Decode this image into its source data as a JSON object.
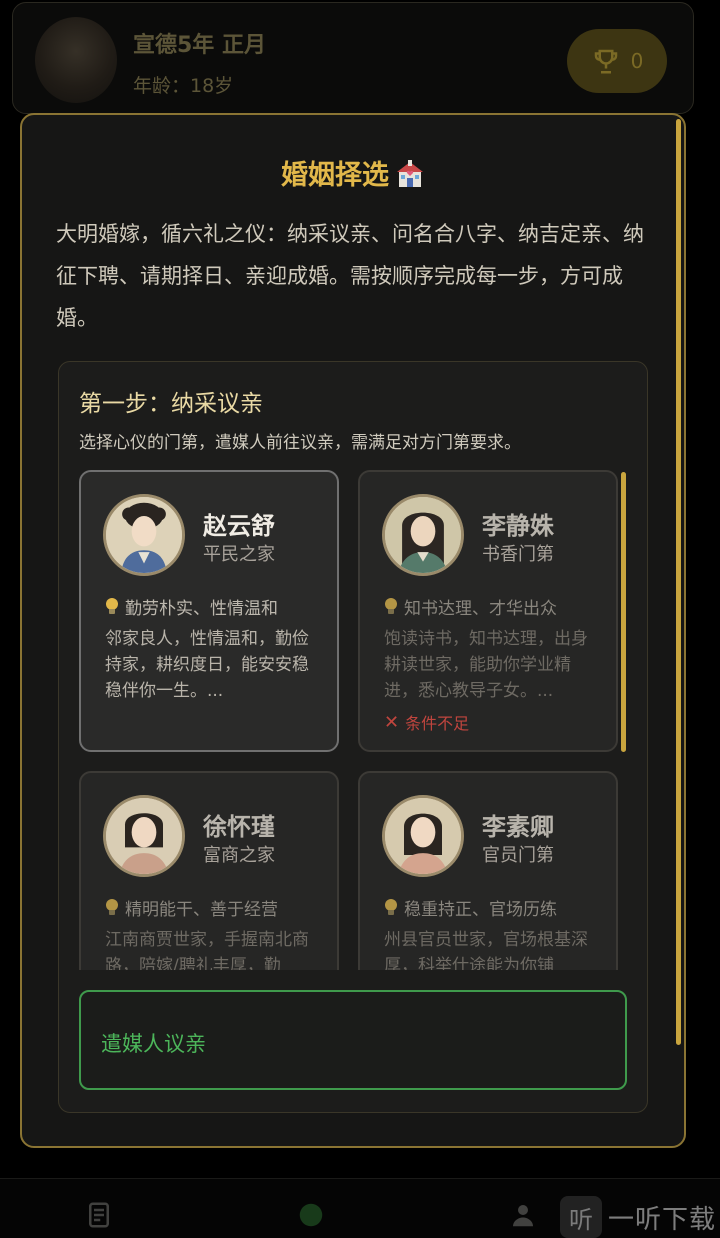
{
  "background": {
    "date_text": "宣德5年 正月",
    "age_text": "年龄：18岁",
    "trophy_count": "0"
  },
  "modal": {
    "title": "婚姻择选",
    "title_emoji": "wedding-chapel-icon",
    "intro": "大明婚嫁，循六礼之仪：纳采议亲、问名合八字、纳吉定亲、纳征下聘、请期择日、亲迎成婚。需按顺序完成每一步，方可成婚。",
    "step": {
      "title": "第一步：纳采议亲",
      "description": "选择心仪的门第，遣媒人前往议亲，需满足对方门第要求。"
    },
    "candidates": [
      {
        "name": "赵云舒",
        "family": "平民之家",
        "trait": "勤劳朴实、性情温和",
        "description": "邻家良人，性情温和，勤俭持家，耕织度日，能安安稳稳伴你一生。...",
        "condition": "",
        "selected": true
      },
      {
        "name": "李静姝",
        "family": "书香门第",
        "trait": "知书达理、才华出众",
        "description": "饱读诗书，知书达理，出身耕读世家，能助你学业精进，悉心教导子女。...",
        "condition": "条件不足",
        "selected": false
      },
      {
        "name": "徐怀瑾",
        "family": "富商之家",
        "trait": "精明能干、善于经营",
        "description": "江南商贾世家，手握南北商路，陪嫁/聘礼丰厚，勤",
        "condition": "",
        "selected": false
      },
      {
        "name": "李素卿",
        "family": "官员门第",
        "trait": "稳重持正、官场历练",
        "description": "州县官员世家，官场根基深厚，科举仕途能为你铺",
        "condition": "",
        "selected": false
      }
    ],
    "action_button": "遣媒人议亲"
  },
  "watermark": {
    "logo": "听",
    "text": "一听下载"
  },
  "colors": {
    "accent_gold": "#e2b84a",
    "button_green": "#4cb55a",
    "warning_red": "#c0453e"
  }
}
